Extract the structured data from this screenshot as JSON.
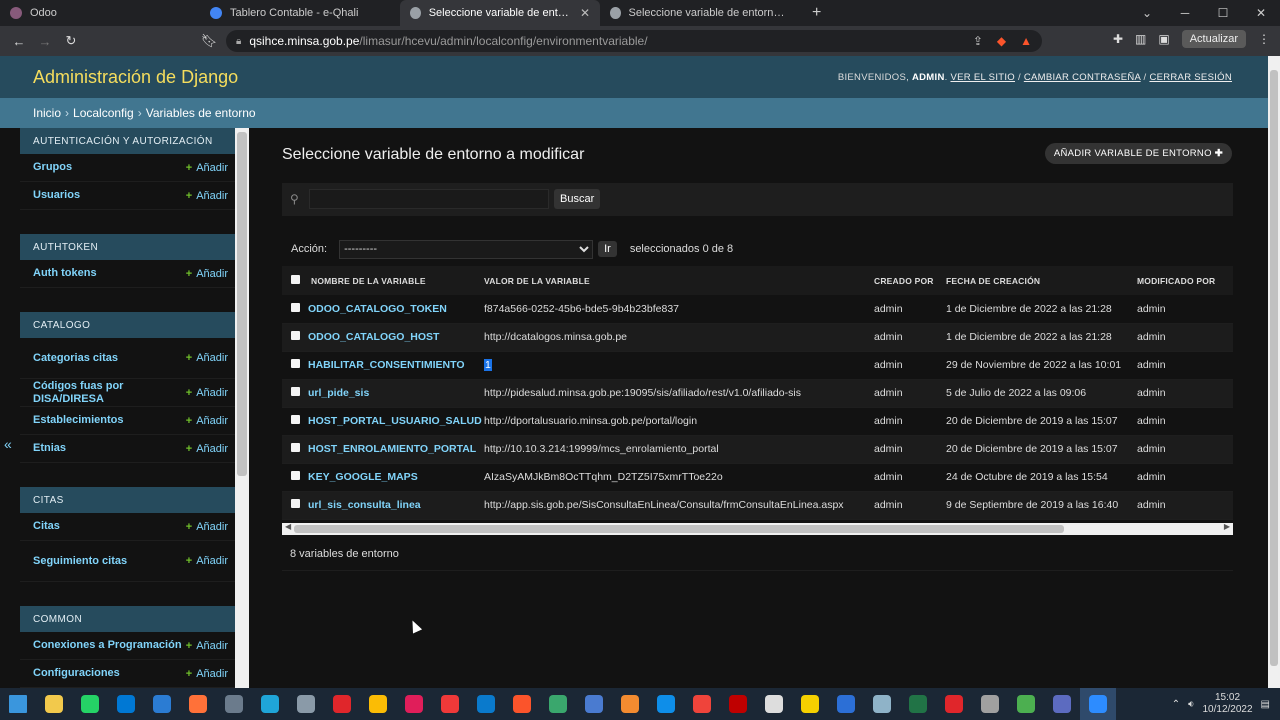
{
  "browser": {
    "tabs": [
      {
        "label": "Odoo",
        "color": "#875a7b",
        "active": false
      },
      {
        "label": "Tablero Contable - e-Qhali",
        "color": "#4285f4",
        "active": false
      },
      {
        "label": "Seleccione variable de entorno a",
        "color": "#9aa0a6",
        "active": true
      },
      {
        "label": "Seleccione variable de entorno a mod",
        "color": "#9aa0a6",
        "active": false
      }
    ],
    "close_glyph": "✕",
    "new_tab_glyph": "+",
    "url_host": "qsihce.minsa.gob.pe",
    "url_path": "/limasur/hcevu/admin/localconfig/environmentvariable/",
    "update_label": "Actualizar"
  },
  "header": {
    "brand": "Administración de Django",
    "welcome": "Bienvenidos,",
    "user": "admin",
    "link_site": "Ver el sitio",
    "link_password": "Cambiar contraseña",
    "link_logout": "Cerrar sesión"
  },
  "breadcrumbs": [
    "Inicio",
    "Localconfig",
    "Variables de entorno"
  ],
  "sidebar": {
    "add_label": "Añadir",
    "modules": [
      {
        "caption": "Autenticación y autorización",
        "items": [
          "Grupos",
          "Usuarios"
        ]
      },
      {
        "caption": "Authtoken",
        "items": [
          "Auth tokens"
        ]
      },
      {
        "caption": "Catalogo",
        "items": [
          "Categorias citas",
          "Códigos fuas por DISA/DIRESA",
          "Establecimientos",
          "Etnias"
        ]
      },
      {
        "caption": "Citas",
        "items": [
          "Citas",
          "Seguimiento citas"
        ]
      },
      {
        "caption": "Common",
        "items": [
          "Conexiones a Programación",
          "Configuraciones"
        ]
      }
    ]
  },
  "main": {
    "title": "Seleccione variable de entorno a modificar",
    "add_button": "Añadir variable de entorno",
    "search_button": "Buscar",
    "action_label": "Acción:",
    "action_selected": "---------",
    "go_button": "Ir",
    "selected_count": "seleccionados 0 de 8",
    "columns": [
      "Nombre de la variable",
      "Valor de la variable",
      "Creado por",
      "Fecha de creación",
      "Modificado por"
    ],
    "rows": [
      [
        "ODOO_CATALOGO_TOKEN",
        "f874a566-0252-45b6-bde5-9b4b23bfe837",
        "admin",
        "1 de Diciembre de 2022 a las 21:28",
        "admin"
      ],
      [
        "ODOO_CATALOGO_HOST",
        "http://dcatalogos.minsa.gob.pe",
        "admin",
        "1 de Diciembre de 2022 a las 21:28",
        "admin"
      ],
      [
        "HABILITAR_CONSENTIMIENTO",
        "1",
        "admin",
        "29 de Noviembre de 2022 a las 10:01",
        "admin"
      ],
      [
        "url_pide_sis",
        "http://pidesalud.minsa.gob.pe:19095/sis/afiliado/rest/v1.0/afiliado-sis",
        "admin",
        "5 de Julio de 2022 a las 09:06",
        "admin"
      ],
      [
        "HOST_PORTAL_USUARIO_SALUD",
        "http://dportalusuario.minsa.gob.pe/portal/login",
        "admin",
        "20 de Diciembre de 2019 a las 15:07",
        "admin"
      ],
      [
        "HOST_ENROLAMIENTO_PORTAL",
        "http://10.10.3.214:19999/mcs_enrolamiento_portal",
        "admin",
        "20 de Diciembre de 2019 a las 15:07",
        "admin"
      ],
      [
        "KEY_GOOGLE_MAPS",
        "AIzaSyAMJkBm8OcTTqhm_D2TZ5I75xmrTToe22o",
        "admin",
        "24 de Octubre de 2019 a las 15:54",
        "admin"
      ],
      [
        "url_sis_consulta_linea",
        "http://app.sis.gob.pe/SisConsultaEnLinea/Consulta/frmConsultaEnLinea.aspx",
        "admin",
        "9 de Septiembre de 2019 a las 16:40",
        "admin"
      ]
    ],
    "result_count": "8 variables de entorno"
  },
  "taskbar": {
    "icons": [
      {
        "name": "windows-start-icon",
        "color": "#3a96dd"
      },
      {
        "name": "file-explorer-icon",
        "color": "#f2c94c"
      },
      {
        "name": "whatsapp-icon",
        "color": "#25d366"
      },
      {
        "name": "outlook-icon",
        "color": "#0078d4"
      },
      {
        "name": "app-icon",
        "color": "#2b7cd3"
      },
      {
        "name": "firefox-icon",
        "color": "#ff7139"
      },
      {
        "name": "calculator-icon",
        "color": "#6b7b8c"
      },
      {
        "name": "edge-icon",
        "color": "#1fa5d8"
      },
      {
        "name": "app-icon",
        "color": "#8a9aa8"
      },
      {
        "name": "opera-icon",
        "color": "#e0262b"
      },
      {
        "name": "chrome-icon",
        "color": "#fbbc05"
      },
      {
        "name": "slack-icon",
        "color": "#e01e5a"
      },
      {
        "name": "vivaldi-icon",
        "color": "#ef3939"
      },
      {
        "name": "vscode-icon",
        "color": "#0a7acc"
      },
      {
        "name": "brave-icon",
        "color": "#fb542b"
      },
      {
        "name": "app-icon",
        "color": "#3aa76d"
      },
      {
        "name": "app-icon",
        "color": "#4a7bd0"
      },
      {
        "name": "app-icon",
        "color": "#f28b30"
      },
      {
        "name": "teamviewer-icon",
        "color": "#0e8ee9"
      },
      {
        "name": "anydesk-icon",
        "color": "#ef443b"
      },
      {
        "name": "filezilla-icon",
        "color": "#bf0000"
      },
      {
        "name": "app-icon",
        "color": "#dddddd"
      },
      {
        "name": "app-icon",
        "color": "#f5d000"
      },
      {
        "name": "nx-icon",
        "color": "#2c6fd6"
      },
      {
        "name": "app-icon",
        "color": "#8fb3c8"
      },
      {
        "name": "excel-icon",
        "color": "#217346"
      },
      {
        "name": "acrobat-icon",
        "color": "#e0262b"
      },
      {
        "name": "app-icon",
        "color": "#a0a0a0"
      },
      {
        "name": "app-icon",
        "color": "#4caf50"
      },
      {
        "name": "git-icon",
        "color": "#5c6bc0"
      },
      {
        "name": "zoom-icon",
        "color": "#2d8cff"
      }
    ],
    "time": "15:02",
    "date": "10/12/2022"
  }
}
